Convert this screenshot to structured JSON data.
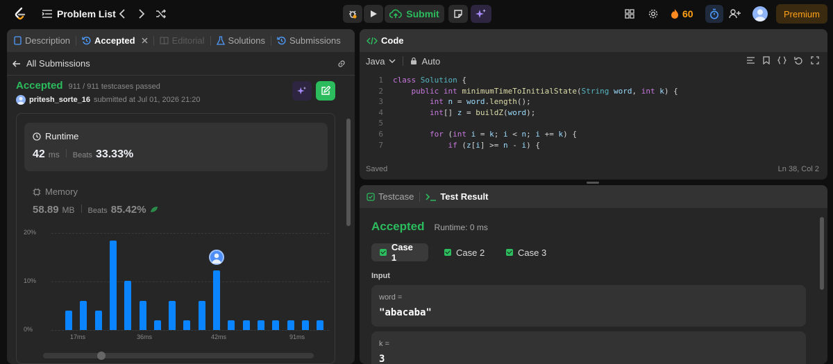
{
  "topbar": {
    "title": "Problem List",
    "submit_label": "Submit",
    "streak": "60",
    "premium_label": "Premium"
  },
  "left_panel": {
    "tabs": [
      {
        "label": "Description"
      },
      {
        "label": "Accepted"
      },
      {
        "label": "Editorial"
      },
      {
        "label": "Solutions"
      },
      {
        "label": "Submissions"
      }
    ],
    "back_label": "All Submissions",
    "status": "Accepted",
    "testcases": "911 / 911 testcases passed",
    "user": "pritesh_sorte_16",
    "submitted_at": "submitted at Jul 01, 2026 21:20",
    "runtime": {
      "title": "Runtime",
      "value": "42",
      "unit": "ms",
      "beats_label": "Beats",
      "beats": "33.33%"
    },
    "memory": {
      "title": "Memory",
      "value": "58.89",
      "unit": "MB",
      "beats_label": "Beats",
      "beats": "85.42%"
    }
  },
  "code_panel": {
    "title": "Code",
    "language": "Java",
    "mode": "Auto",
    "status": "Saved",
    "cursor": "Ln 38, Col 2"
  },
  "result_panel": {
    "tab_testcase": "Testcase",
    "tab_result": "Test Result",
    "status": "Accepted",
    "runtime": "Runtime: 0 ms",
    "cases": [
      "Case 1",
      "Case 2",
      "Case 3"
    ],
    "input_label": "Input",
    "params": [
      {
        "name": "word =",
        "value": "\"abacaba\""
      },
      {
        "name": "k =",
        "value": "3"
      }
    ]
  },
  "chart_data": {
    "type": "bar",
    "y_ticks": [
      "20%",
      "10%",
      "0%"
    ],
    "x_ticks": [
      "17ms",
      "36ms",
      "42ms",
      "91ms"
    ],
    "ylim": [
      0,
      20
    ],
    "values": [
      4,
      6,
      4,
      18.5,
      10.2,
      6,
      2,
      6,
      2,
      6,
      12.3,
      2,
      2,
      2,
      2,
      2,
      2,
      2
    ],
    "highlight_index": 10,
    "colors": {
      "bar": "#0a84ff"
    }
  },
  "colors": {
    "accent_green": "#2cbb5d",
    "accent_orange": "#ffa116",
    "panel": "#262626"
  }
}
